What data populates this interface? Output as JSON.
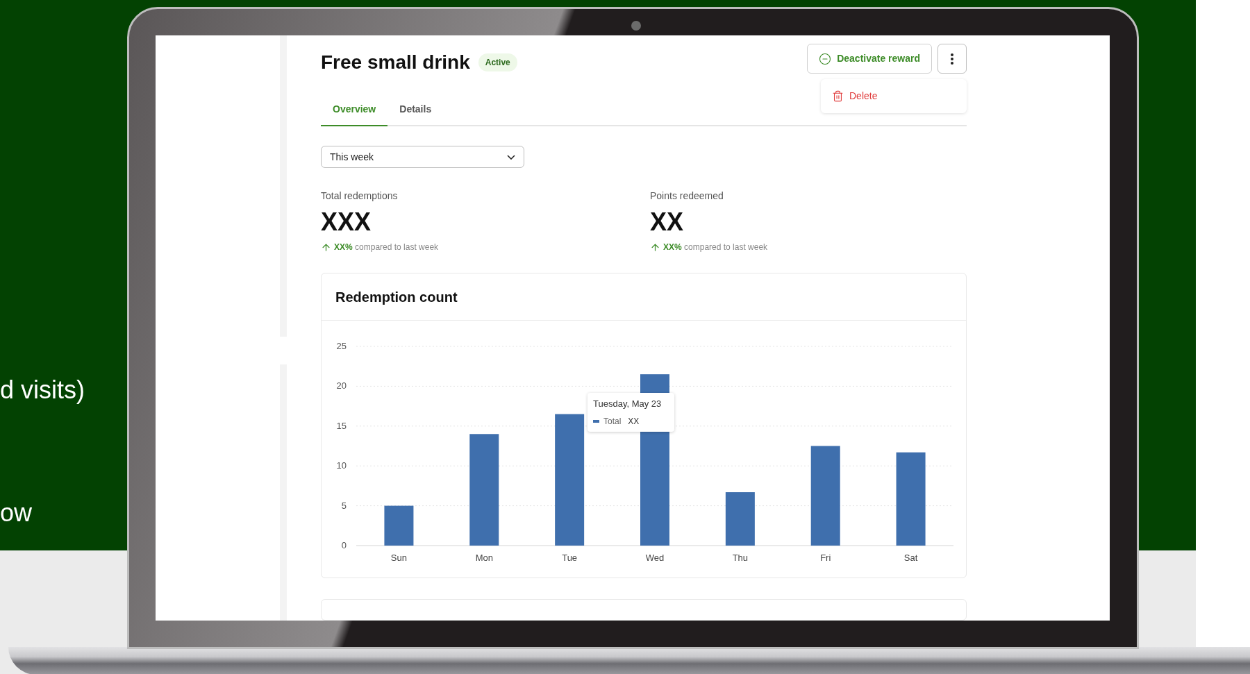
{
  "backdrop_text": [
    "d visits)",
    "ow"
  ],
  "header": {
    "title": "Free small drink",
    "status": "Active",
    "deactivate_button": "Deactivate reward",
    "menu": {
      "expanded": true,
      "items": [
        {
          "label": "Delete",
          "kind": "danger"
        }
      ]
    }
  },
  "tabs": [
    {
      "label": "Overview",
      "selected": true
    },
    {
      "label": "Details",
      "selected": false
    }
  ],
  "period_select": {
    "value": "This week"
  },
  "stats": [
    {
      "label": "Total redemptions",
      "value": "XXX",
      "change": "XX%",
      "comparison": "compared to last week"
    },
    {
      "label": "Points redeemed",
      "value": "XX",
      "change": "XX%",
      "comparison": "compared to last week"
    }
  ],
  "redemption_chart": {
    "title": "Redemption count",
    "chart_data": {
      "type": "bar",
      "categories": [
        "Sun",
        "Mon",
        "Tue",
        "Wed",
        "Thu",
        "Fri",
        "Sat"
      ],
      "series": [
        {
          "name": "Total",
          "color": "#3f6fad",
          "values": [
            5,
            14,
            16.5,
            21.5,
            6.7,
            12.5,
            11.7
          ]
        }
      ],
      "ylim": [
        0,
        25
      ],
      "yticks": [
        0,
        5,
        10,
        15,
        20,
        25
      ],
      "grid": true
    },
    "tooltip": {
      "title": "Tuesday, May 23",
      "value": "XX"
    }
  }
}
